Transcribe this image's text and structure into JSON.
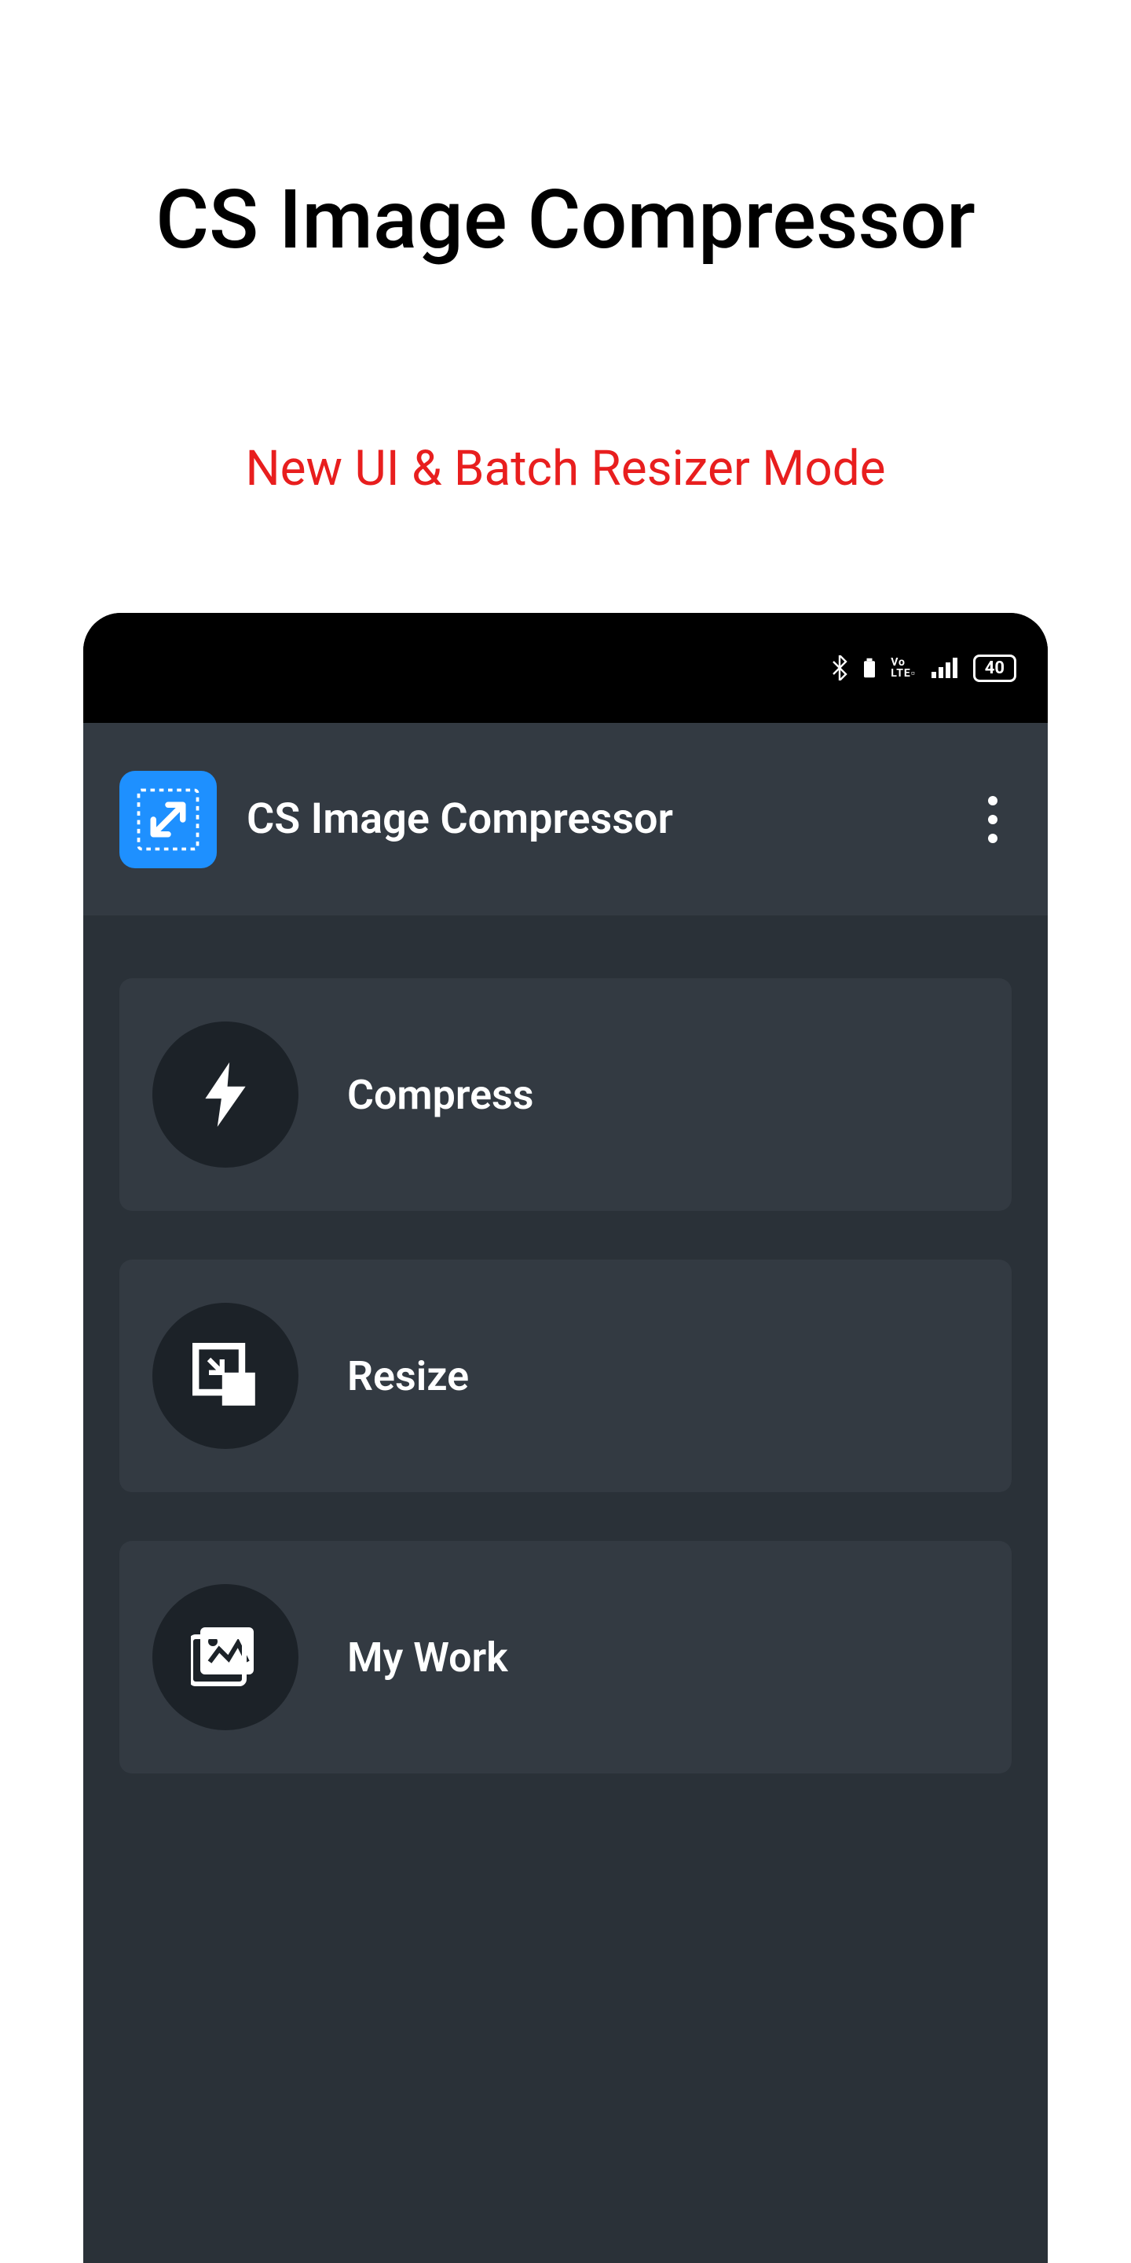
{
  "promo": {
    "title": "CS Image Compressor",
    "subtitle": "New UI & Batch Resizer Mode"
  },
  "status_bar": {
    "bluetooth": true,
    "volte": "Vo LTE",
    "battery_level": "40"
  },
  "app": {
    "title": "CS Image Compressor",
    "menu_items": [
      {
        "label": "Compress",
        "icon": "flash-icon"
      },
      {
        "label": "Resize",
        "icon": "resize-icon"
      },
      {
        "label": "My Work",
        "icon": "gallery-icon"
      }
    ]
  }
}
